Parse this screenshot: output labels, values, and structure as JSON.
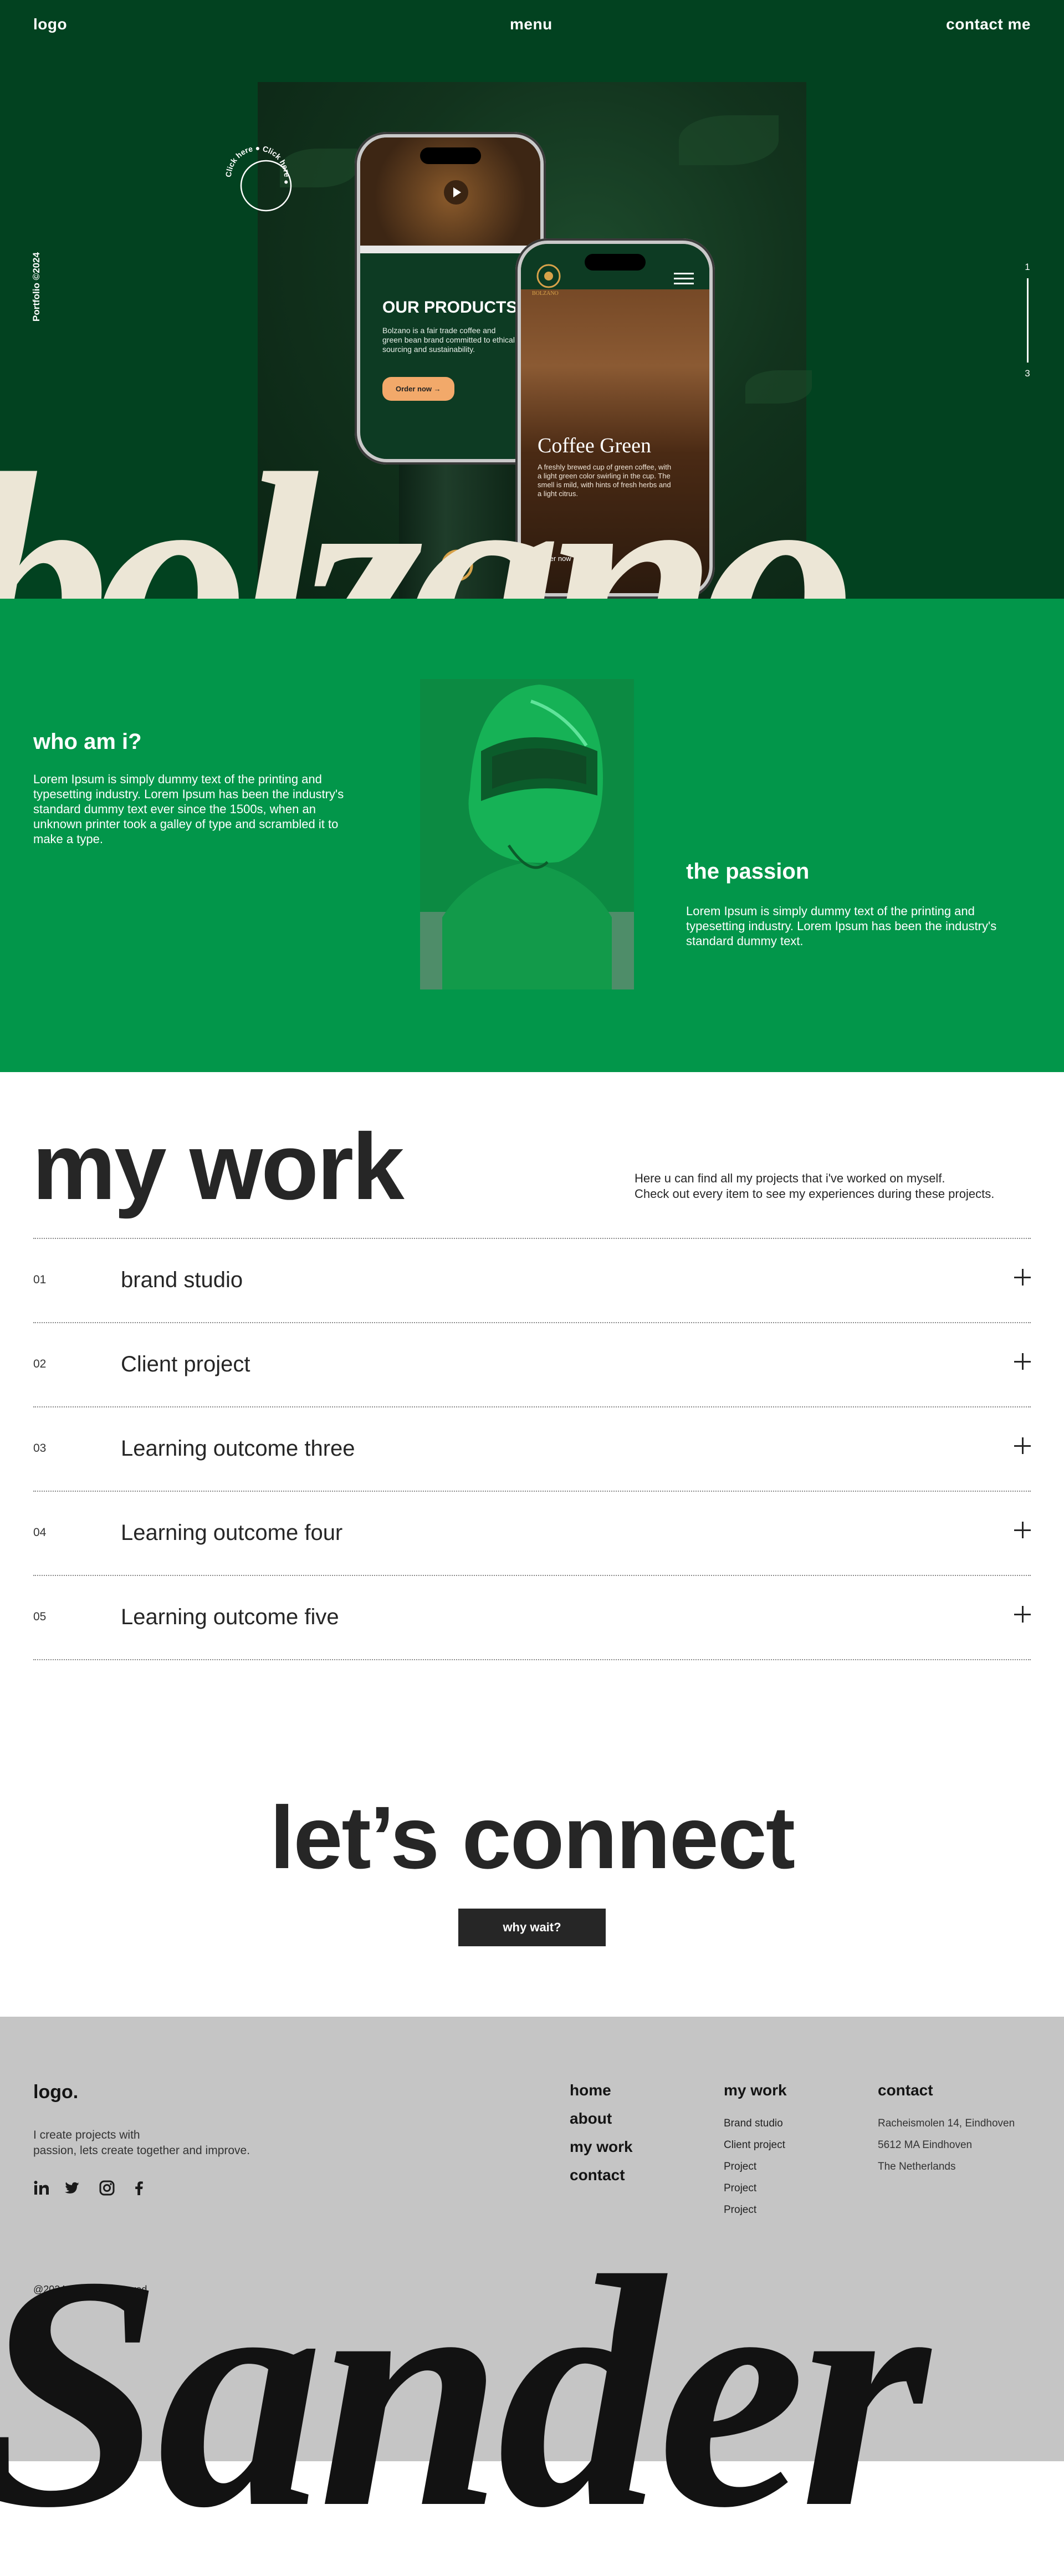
{
  "header": {
    "logo": "logo",
    "menu": "menu",
    "contact": "contact me"
  },
  "hero": {
    "side_caption": "Portfolio ©2024",
    "slider_start": "1",
    "slider_end": "3",
    "badge_text": "Click here ● Click here ●",
    "big_word": "bolzano",
    "phone_left": {
      "title": "OUR PRODUCTS",
      "text": "Bolzano is a fair trade coffee and green bean brand committed to ethical sourcing and sustainability.",
      "button": "Order now →"
    },
    "phone_right": {
      "brand": "BOLZANO",
      "title": "Coffee Green",
      "text": "A freshly brewed cup of green coffee, with a light green color swirling in the cup. The smell is mild, with hints of fresh herbs and a light citrus.",
      "button": "Order now"
    }
  },
  "about": {
    "who_title": "who am i?",
    "who_text": "Lorem Ipsum is simply dummy text of the printing and typesetting industry. Lorem Ipsum has been the industry's standard dummy text ever since the 1500s, when an unknown printer took a galley of type and scrambled it to make a type.",
    "passion_title": "the passion",
    "passion_text": "Lorem Ipsum is simply dummy text of the printing and typesetting industry. Lorem Ipsum has been the industry's standard dummy text."
  },
  "work": {
    "title": "my work",
    "desc_line1": "Here u can find all my projects that i've worked on myself.",
    "desc_line2": "Check out every item to see my experiences during these projects.",
    "items": [
      {
        "num": "01",
        "label": "brand studio"
      },
      {
        "num": "02",
        "label": "Client project"
      },
      {
        "num": "03",
        "label": "Learning outcome three"
      },
      {
        "num": "04",
        "label": "Learning outcome four"
      },
      {
        "num": "05",
        "label": "Learning outcome five"
      }
    ]
  },
  "connect": {
    "title": "let’s connect",
    "button": "why wait?"
  },
  "footer": {
    "logo": "logo.",
    "tagline_line1": "I create projects with",
    "tagline_line2": "passion, lets create together and improve.",
    "social_icons": [
      "linkedin-icon",
      "twitter-icon",
      "instagram-icon",
      "facebook-icon"
    ],
    "nav": [
      "home",
      "about",
      "my work",
      "contact"
    ],
    "my_work_heading": "my work",
    "my_work_links": [
      "Brand studio",
      "Client project",
      "Project",
      "Project",
      "Project"
    ],
    "contact_heading": "contact",
    "address": [
      "Racheismolen 14, Eindhoven",
      "5612 MA Eindhoven",
      "The Netherlands"
    ],
    "copyright": "@2024 all rights reserved",
    "big_word": "Sander"
  },
  "colors": {
    "hero_bg": "#024220",
    "about_bg": "#02964a",
    "cream": "#ece6d6",
    "dark": "#262626",
    "footer_bg": "#c5c5c5",
    "accent_orange": "#f2a96a"
  }
}
